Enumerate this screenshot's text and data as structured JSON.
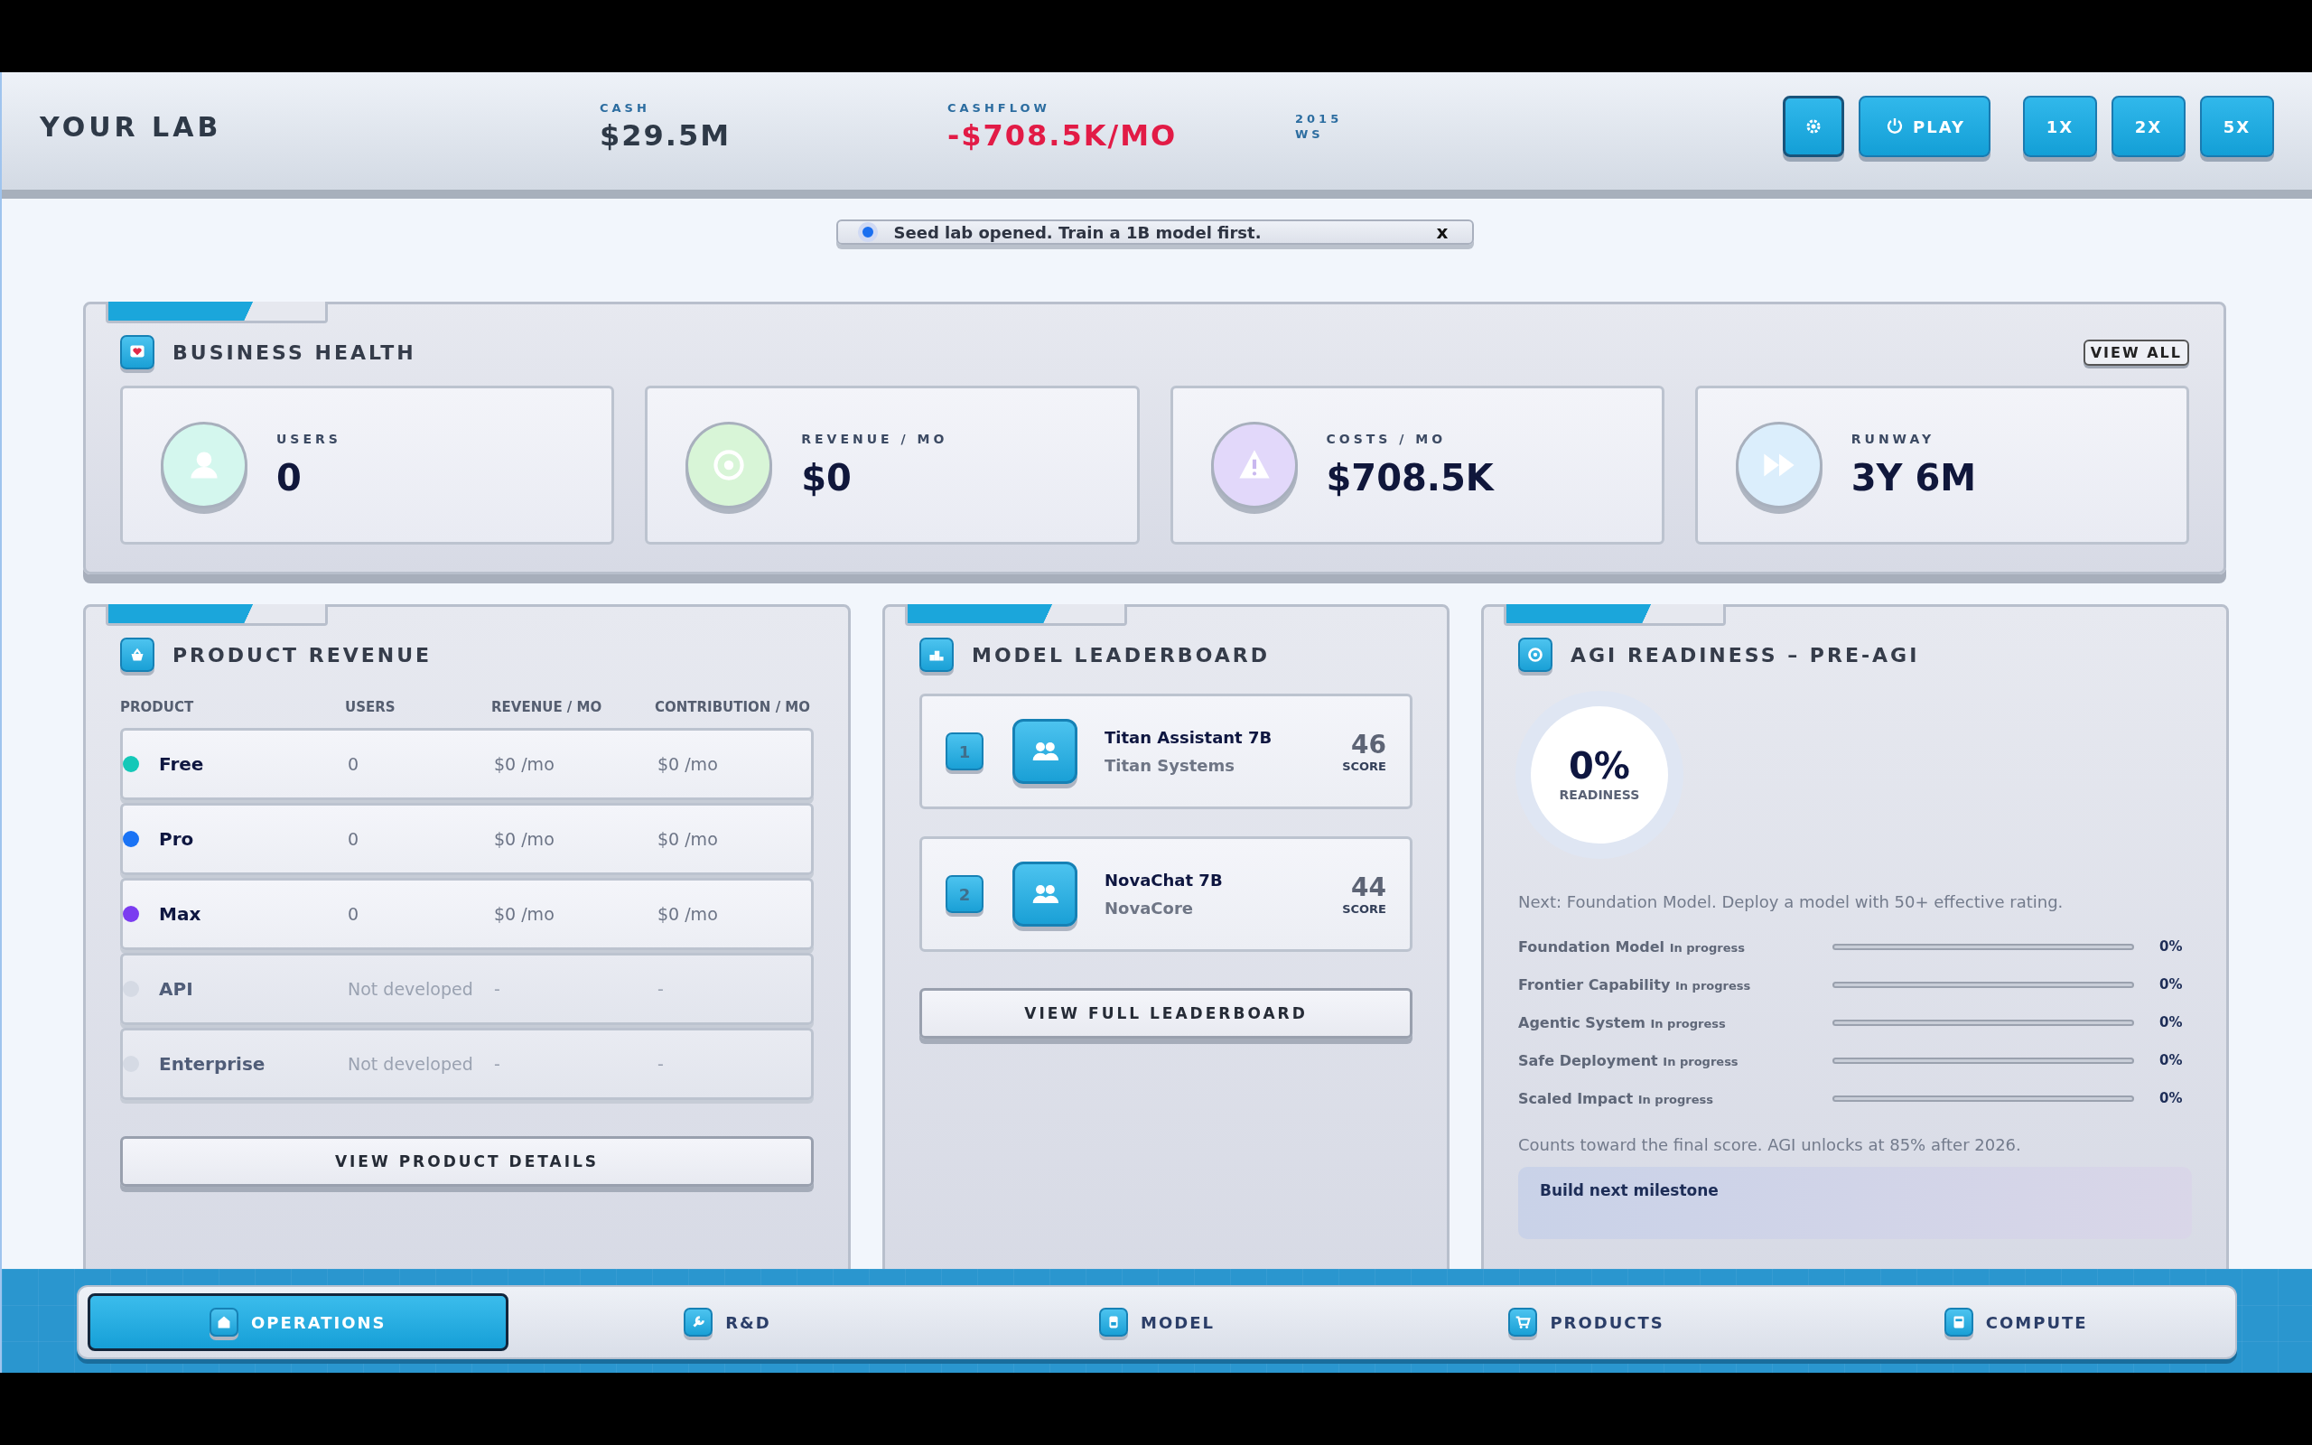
{
  "header": {
    "title": "YOUR LAB",
    "stats": [
      {
        "label": "CASH",
        "value": "$29.5M",
        "kind": "normal"
      },
      {
        "label": "CASHFLOW",
        "value": "-$708.5K/MO",
        "kind": "negative"
      }
    ],
    "date": {
      "year": "2015",
      "season": "WS"
    },
    "controls": [
      {
        "kind": "settings"
      },
      {
        "kind": "play",
        "label": "PLAY"
      },
      {
        "kind": "speed",
        "label": "1X"
      },
      {
        "kind": "speed",
        "label": "2X"
      },
      {
        "kind": "speed",
        "label": "5X"
      }
    ]
  },
  "toast": {
    "message": "Seed lab opened. Train a 1B model first.",
    "close": "x"
  },
  "business_health": {
    "title": "BUSINESS HEALTH",
    "action": "VIEW ALL",
    "metrics": [
      {
        "label": "USERS",
        "value": "0",
        "kind": "users"
      },
      {
        "label": "REVENUE / MO",
        "value": "$0",
        "kind": "revenue"
      },
      {
        "label": "COSTS / MO",
        "value": "$708.5K",
        "kind": "costs"
      },
      {
        "label": "RUNWAY",
        "value": "3Y 6M",
        "kind": "runway"
      }
    ]
  },
  "product_revenue": {
    "title": "PRODUCT REVENUE",
    "columns": [
      "PRODUCT",
      "USERS",
      "REVENUE / MO",
      "CONTRIBUTION / MO"
    ],
    "rows": [
      {
        "name": "Free",
        "users": "0",
        "revenue": "$0 /mo",
        "contribution": "$0 /mo",
        "color": "#14c8b8",
        "available": true
      },
      {
        "name": "Pro",
        "users": "0",
        "revenue": "$0 /mo",
        "contribution": "$0 /mo",
        "color": "#1a73f5",
        "available": true
      },
      {
        "name": "Max",
        "users": "0",
        "revenue": "$0 /mo",
        "contribution": "$0 /mo",
        "color": "#7b3cf0",
        "available": true
      },
      {
        "name": "API",
        "users": "Not developed",
        "revenue": "-",
        "contribution": "-",
        "color": "#d5dae4",
        "available": false
      },
      {
        "name": "Enterprise",
        "users": "Not developed",
        "revenue": "-",
        "contribution": "-",
        "color": "#d5dae4",
        "available": false
      }
    ],
    "button": "VIEW PRODUCT DETAILS"
  },
  "leaderboard": {
    "title": "MODEL LEADERBOARD",
    "entries": [
      {
        "rank": "1",
        "name": "Titan Assistant 7B",
        "company": "Titan Systems",
        "score": "46",
        "score_label": "SCORE"
      },
      {
        "rank": "2",
        "name": "NovaChat 7B",
        "company": "NovaCore",
        "score": "44",
        "score_label": "SCORE"
      }
    ],
    "button": "VIEW FULL LEADERBOARD"
  },
  "agi": {
    "title": "AGI READINESS – PRE-AGI",
    "readiness": {
      "value": "0%",
      "label": "READINESS",
      "level": 0
    },
    "next": "Next: Foundation Model. Deploy a model with 50+ effective rating.",
    "milestones": [
      {
        "name": "Foundation Model",
        "status": "In progress",
        "level": 0,
        "percent": "0%"
      },
      {
        "name": "Frontier Capability",
        "status": "In progress",
        "level": 0,
        "percent": "0%"
      },
      {
        "name": "Agentic System",
        "status": "In progress",
        "level": 0,
        "percent": "0%"
      },
      {
        "name": "Safe Deployment",
        "status": "In progress",
        "level": 0,
        "percent": "0%"
      },
      {
        "name": "Scaled Impact",
        "status": "In progress",
        "level": 0,
        "percent": "0%"
      }
    ],
    "note": "Counts toward the final score. AGI unlocks at 85% after 2026.",
    "build_title": "Build next milestone"
  },
  "nav": [
    {
      "label": "OPERATIONS",
      "kind": "home",
      "selected": true
    },
    {
      "label": "R&D",
      "kind": "wrench",
      "selected": false
    },
    {
      "label": "MODEL",
      "kind": "model",
      "selected": false
    },
    {
      "label": "PRODUCTS",
      "kind": "cart",
      "selected": false
    },
    {
      "label": "COMPUTE",
      "kind": "compute",
      "selected": false
    }
  ]
}
